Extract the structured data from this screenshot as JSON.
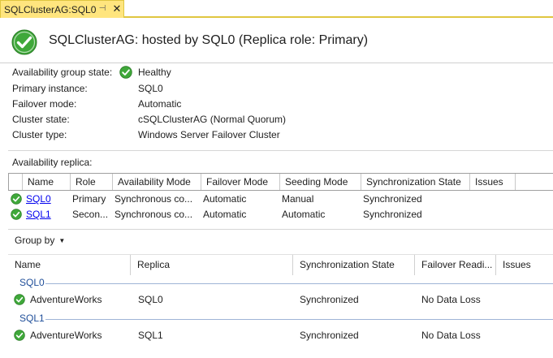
{
  "tab": {
    "title": "SQLClusterAG:SQL0",
    "pin_glyph": "⊣",
    "close_glyph": "✕"
  },
  "header": {
    "title": "SQLClusterAG: hosted by SQL0 (Replica role: Primary)",
    "icon": "green-check-icon"
  },
  "properties": [
    {
      "label": "Availability group state:",
      "value": "Healthy",
      "icon": "green-check-icon"
    },
    {
      "label": "Primary instance:",
      "value": "SQL0"
    },
    {
      "label": "Failover mode:",
      "value": "Automatic"
    },
    {
      "label": "Cluster state:",
      "value": "cSQLClusterAG (Normal Quorum)"
    },
    {
      "label": "Cluster type:",
      "value": "Windows Server Failover Cluster"
    }
  ],
  "replica_section": {
    "label": "Availability replica:",
    "columns": [
      "Name",
      "Role",
      "Availability Mode",
      "Failover Mode",
      "Seeding Mode",
      "Synchronization State",
      "Issues"
    ],
    "rows": [
      {
        "name": "SQL0",
        "role": "Primary",
        "availability_mode": "Synchronous co...",
        "failover_mode": "Automatic",
        "seeding_mode": "Manual",
        "sync_state": "Synchronized",
        "issues": ""
      },
      {
        "name": "SQL1",
        "role": "Secon...",
        "availability_mode": "Synchronous co...",
        "failover_mode": "Automatic",
        "seeding_mode": "Automatic",
        "sync_state": "Synchronized",
        "issues": ""
      }
    ]
  },
  "group_by": {
    "label": "Group by",
    "caret": "▼"
  },
  "database_list": {
    "columns": [
      "Name",
      "Replica",
      "Synchronization State",
      "Failover Readi...",
      "Issues"
    ],
    "groups": [
      {
        "label": "SQL0",
        "rows": [
          {
            "name": "AdventureWorks",
            "replica": "SQL0",
            "sync_state": "Synchronized",
            "failover_readiness": "No Data Loss",
            "issues": ""
          }
        ]
      },
      {
        "label": "SQL1",
        "rows": [
          {
            "name": "AdventureWorks",
            "replica": "SQL1",
            "sync_state": "Synchronized",
            "failover_readiness": "No Data Loss",
            "issues": ""
          }
        ]
      }
    ]
  },
  "colors": {
    "tab_active": "#ffe57e",
    "tab_border": "#e0c640",
    "check_green": "#3fa83a",
    "link": "#0000ee",
    "group_label": "#1f4e99"
  }
}
